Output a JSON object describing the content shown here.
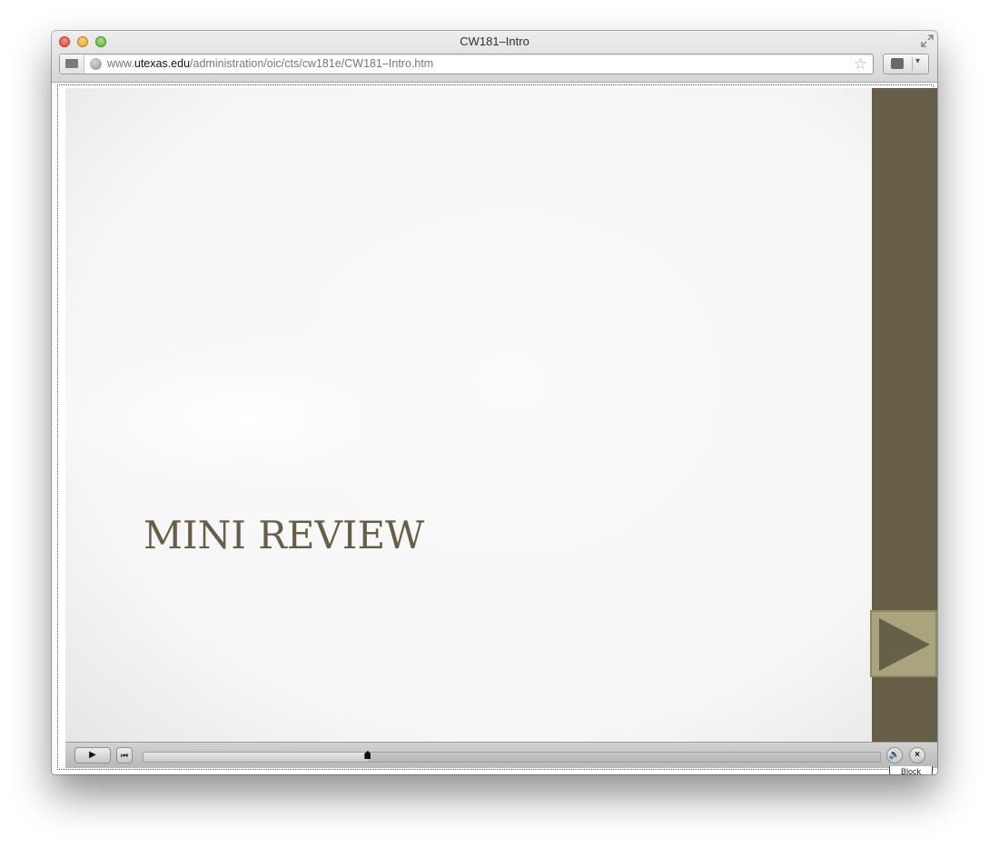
{
  "window": {
    "title": "CW181–Intro"
  },
  "address_bar": {
    "url_prefix": "www.",
    "url_domain": "utexas.edu",
    "url_path": "/administration/oic/cts/cw181e/CW181–Intro.htm"
  },
  "slide": {
    "title": "MINI REVIEW",
    "title_color": "#685e48",
    "sidebar_color": "#675e47",
    "next_button_color": "#aaa47e",
    "next_icon": "play-triangle-icon"
  },
  "player": {
    "play_icon": "▶",
    "rewind_icon": "⏮",
    "volume_icon": "🔊",
    "close_icon": "×",
    "progress_fraction": 0.305
  },
  "plugin_tab": {
    "label": "Block"
  }
}
